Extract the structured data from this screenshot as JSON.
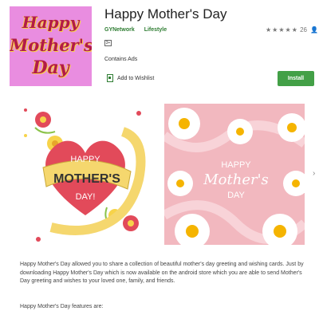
{
  "app": {
    "title": "Happy Mother's Day",
    "developer": "GYNetwork",
    "category": "Lifestyle",
    "rating_count": "26",
    "age_rating": "3+",
    "contains_ads": "Contains Ads",
    "wishlist_label": "Add to Wishlist",
    "install_label": "Install"
  },
  "icon": {
    "line1": "Happy",
    "line2": "Mother's",
    "line3": "Day"
  },
  "screenshot1": {
    "line1": "HAPPY",
    "line2": "MOTHER'S",
    "line3": "DAY!"
  },
  "screenshot2": {
    "line1": "HAPPY",
    "line2": "Mother's",
    "line3": "DAY"
  },
  "description": {
    "paragraph1": "Happy Mother's Day allowed you to share a collection of beautiful mother's day greeting and wishing cards. Just by downloading Happy Mother's Day which is now available on the android store which you are able to send Mother's Day greeting and wishes to your loved one, family, and friends.",
    "paragraph2": "Happy Mother's Day features are:"
  },
  "colors": {
    "accent_green": "#43a047",
    "icon_bg": "#e98de0",
    "heart_red": "#e24a5a",
    "banner_yellow": "#f5d76e",
    "shot2_bg": "#f2b8bf"
  },
  "icons": {
    "bookmark": "bookmark-icon",
    "star": "star-icon",
    "person": "person-icon",
    "next": "chevron-right-icon"
  }
}
